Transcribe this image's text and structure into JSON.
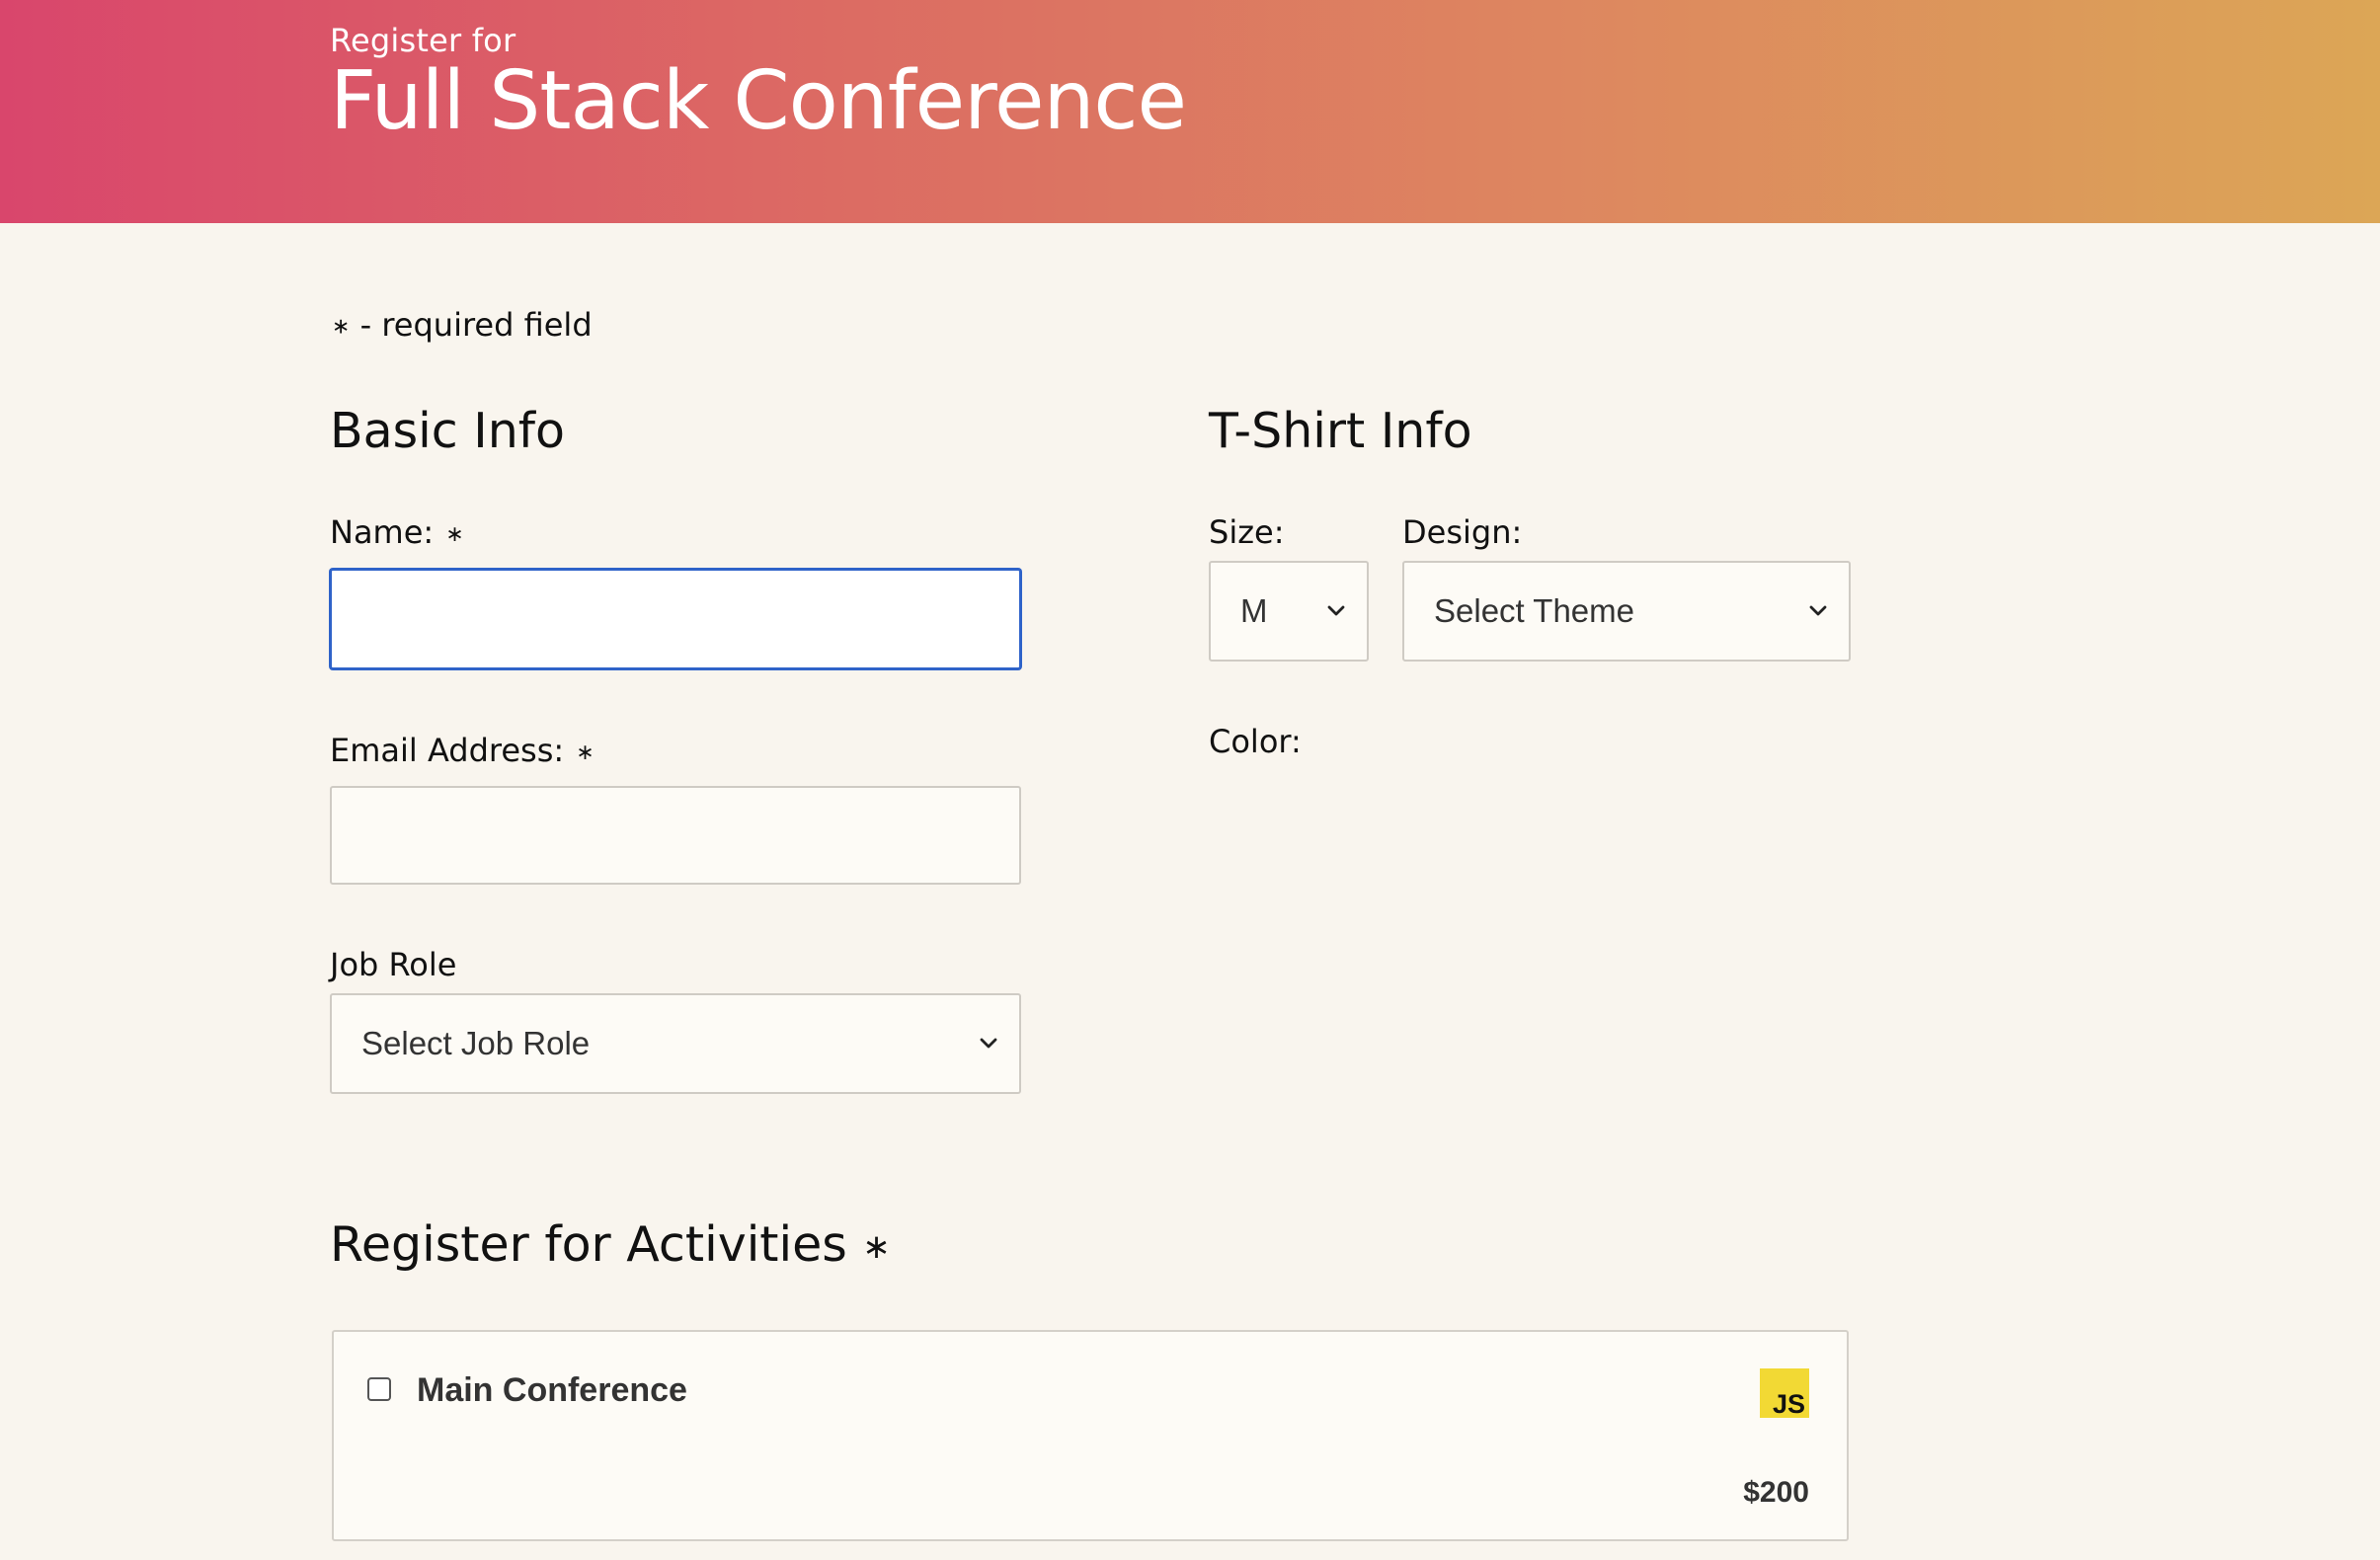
{
  "header": {
    "pre_title": "Register for",
    "title": "Full Stack Conference"
  },
  "required_note": {
    "star": "∗",
    "text": " - required field"
  },
  "basic_info": {
    "title": "Basic Info",
    "name_label": "Name:",
    "name_value": "",
    "email_label": "Email Address:",
    "email_value": "",
    "job_role_label": "Job Role",
    "job_role_selected": "Select Job Role",
    "required_star": "∗"
  },
  "tshirt_info": {
    "title": "T-Shirt Info",
    "size_label": "Size:",
    "size_selected": "M",
    "design_label": "Design:",
    "design_selected": "Select Theme",
    "color_label": "Color:"
  },
  "activities": {
    "title": "Register for Activities",
    "required_star": "∗",
    "items": [
      {
        "name": "Main Conference",
        "badge": "JS",
        "price": "$200",
        "checked": false
      }
    ]
  },
  "colors": {
    "header_gradient_start": "#d9466c",
    "header_gradient_end": "#dca656",
    "page_background": "#f9f5ee",
    "focus_border": "#2f63c9",
    "js_badge": "#f2d934"
  },
  "icons": {
    "select_arrow": "chevron-down-icon"
  }
}
